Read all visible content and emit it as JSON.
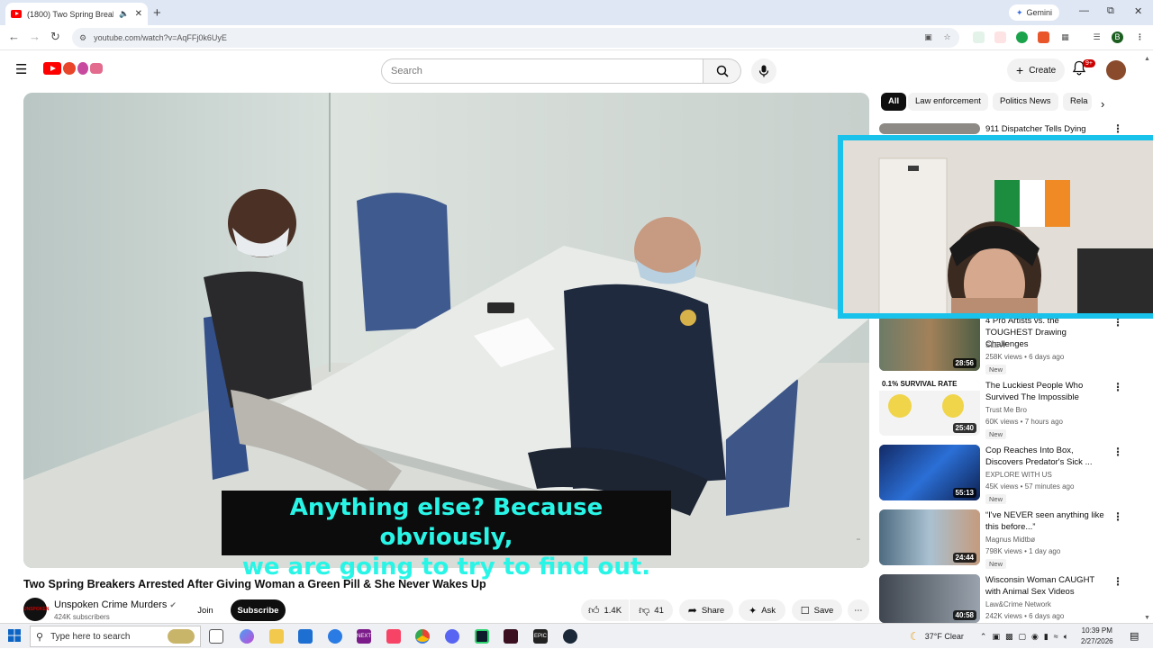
{
  "browser": {
    "tab_title": "(1800) Two Spring Breakers",
    "new_tab": "+",
    "gemini_label": "Gemini",
    "url": "youtube.com/watch?v=AqFFj0k6UyE"
  },
  "youtube": {
    "search_placeholder": "Search",
    "create_label": "Create",
    "notifications_badge": "9+"
  },
  "video": {
    "caption_line1": "Anything else? Because obviously,",
    "caption_line2": "we are going to try to find out.",
    "title": "Two Spring Breakers Arrested After Giving Woman a Green Pill & She Never Wakes Up",
    "channel": "Unspoken Crime Murders",
    "subscribers": "424K subscribers",
    "join_label": "Join",
    "subscribe_label": "Subscribe",
    "likes": "1.4K",
    "dislikes": "41",
    "share_label": "Share",
    "ask_label": "Ask",
    "save_label": "Save"
  },
  "chips": [
    "All",
    "Law enforcement",
    "Politics News",
    "Rela"
  ],
  "related": [
    {
      "title": "911 Dispatcher Tells Dying",
      "channel": "",
      "views": "",
      "duration": "",
      "new": ""
    },
    {
      "title": "4 Pro Artists vs. the TOUGHEST Drawing Challenges",
      "channel": "SLEW",
      "views": "258K views • 6 days ago",
      "duration": "28:56",
      "new": "New"
    },
    {
      "title": "The Luckiest People Who Survived The Impossible",
      "channel": "Trust Me Bro",
      "views": "60K views • 7 hours ago",
      "duration": "25:40",
      "new": "New"
    },
    {
      "title": "Cop Reaches Into Box, Discovers Predator's Sick ...",
      "channel": "EXPLORE WITH US",
      "views": "45K views • 57 minutes ago",
      "duration": "55:13",
      "new": "New"
    },
    {
      "title": "“I've NEVER seen anything like this before...”",
      "channel": "Magnus Midtbø",
      "views": "798K views • 1 day ago",
      "duration": "24:44",
      "new": "New"
    },
    {
      "title": "Wisconsin Woman CAUGHT with Animal Sex Videos",
      "channel": "Law&Crime Network",
      "views": "242K views • 6 days ago",
      "duration": "40:58",
      "new": ""
    }
  ],
  "taskbar": {
    "search_placeholder": "Type here to search",
    "weather": "37°F  Clear",
    "time": "10:39 PM",
    "date": "2/27/2026"
  }
}
